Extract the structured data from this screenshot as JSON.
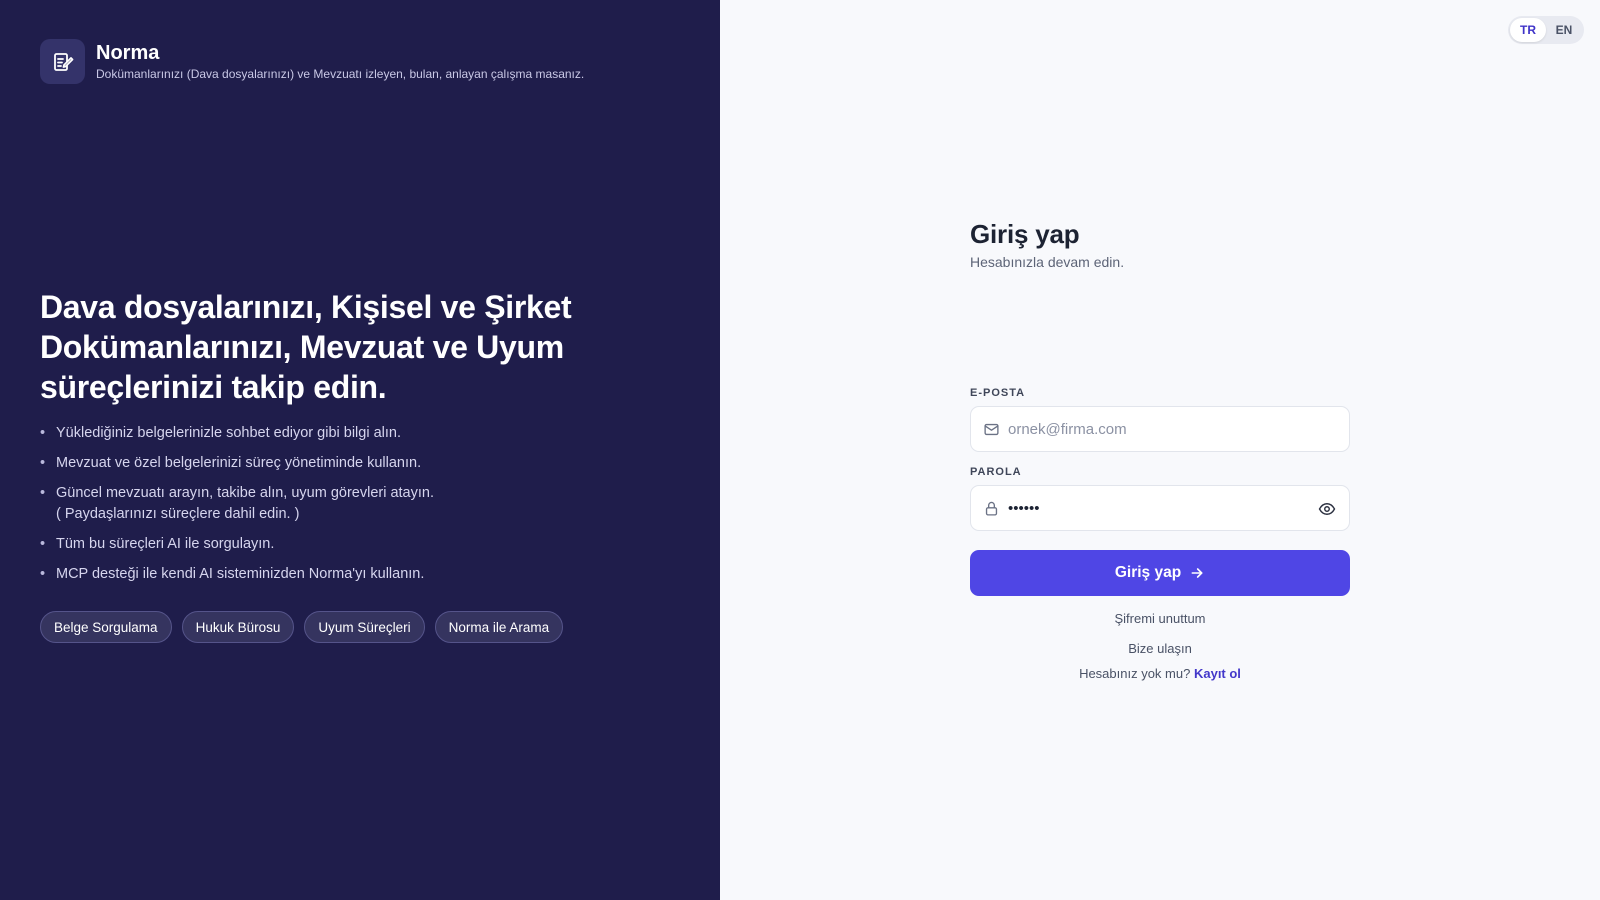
{
  "brand": {
    "name": "Norma",
    "tagline": "Dokümanlarınızı (Dava dosyalarınızı) ve Mevzuatı izleyen, bulan, anlayan çalışma masanız."
  },
  "hero": {
    "headline_line1": "Dava dosyalarınızı, Kişisel ve Şirket",
    "headline_line2": "Dokümanlarınızı, Mevzuat ve Uyum",
    "headline_line3": "süreçlerinizi takip edin."
  },
  "features": [
    "Yüklediğiniz belgelerinizle sohbet ediyor gibi bilgi alın.",
    "Mevzuat ve özel belgelerinizi süreç yönetiminde kullanın.",
    "Güncel mevzuatı arayın, takibe alın, uyum görevleri atayın.",
    "( Paydaşlarınızı süreçlere dahil edin. )",
    "Tüm bu süreçleri AI ile sorgulayın.",
    "MCP desteği ile kendi AI sisteminizden Norma'yı kullanın."
  ],
  "tags": [
    "Belge Sorgulama",
    "Hukuk Bürosu",
    "Uyum Süreçleri",
    "Norma ile Arama"
  ],
  "language": {
    "active": "TR",
    "options": [
      "TR",
      "EN"
    ]
  },
  "login": {
    "title": "Giriş yap",
    "subtitle": "Hesabınızla devam edin.",
    "email_label": "E-POSTA",
    "email_placeholder": "ornek@firma.com",
    "password_label": "PAROLA",
    "password_value": "••••••",
    "submit_label": "Giriş yap",
    "forgot_label": "Şifremi unuttum",
    "contact_label": "Bize ulaşın",
    "no_account_text": "Hesabınız yok mu?",
    "register_label": "Kayıt ol"
  },
  "colors": {
    "left_bg": "#1f1d4b",
    "accent": "#4f46e5",
    "link": "#4338ca",
    "page_bg": "#f8f9fc"
  },
  "icons": {
    "brand": "document-edit-icon",
    "email": "mail-icon",
    "password": "lock-icon",
    "toggle": "eye-icon",
    "submit": "arrow-right-icon"
  }
}
